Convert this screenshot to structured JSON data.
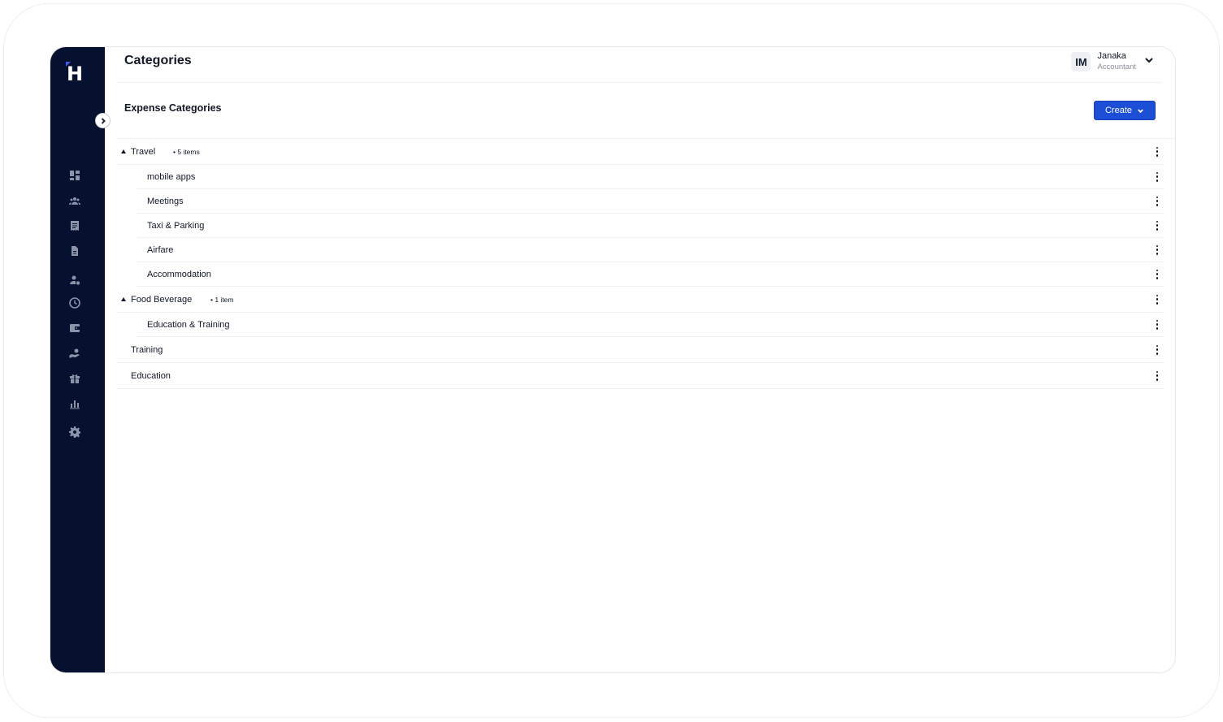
{
  "header": {
    "title": "Categories",
    "user": {
      "initials": "IM",
      "name": "Janaka",
      "role": "Accountant"
    }
  },
  "section": {
    "title": "Expense Categories",
    "create_label": "Create"
  },
  "sidebar": {
    "logo": "H",
    "icons": [
      "dashboard-icon",
      "team-icon",
      "receipt-icon",
      "document-icon",
      "user-settings-icon",
      "clock-icon",
      "wallet-icon",
      "money-hand-icon",
      "gift-icon",
      "bar-chart-icon",
      "gear-icon"
    ]
  },
  "categories": [
    {
      "label": "Travel",
      "count": "• 5 items",
      "expanded": true,
      "children": [
        "mobile apps",
        "Meetings",
        "Taxi & Parking",
        "Airfare",
        "Accommodation"
      ]
    },
    {
      "label": "Food Beverage",
      "count": "• 1 item",
      "expanded": true,
      "children": [
        "Education & Training"
      ]
    },
    {
      "label": "Training",
      "count": "",
      "expanded": false,
      "children": []
    },
    {
      "label": "Education",
      "count": "",
      "expanded": false,
      "children": []
    }
  ],
  "colors": {
    "sidebar": "#061130",
    "primary": "#1d4ed8"
  }
}
